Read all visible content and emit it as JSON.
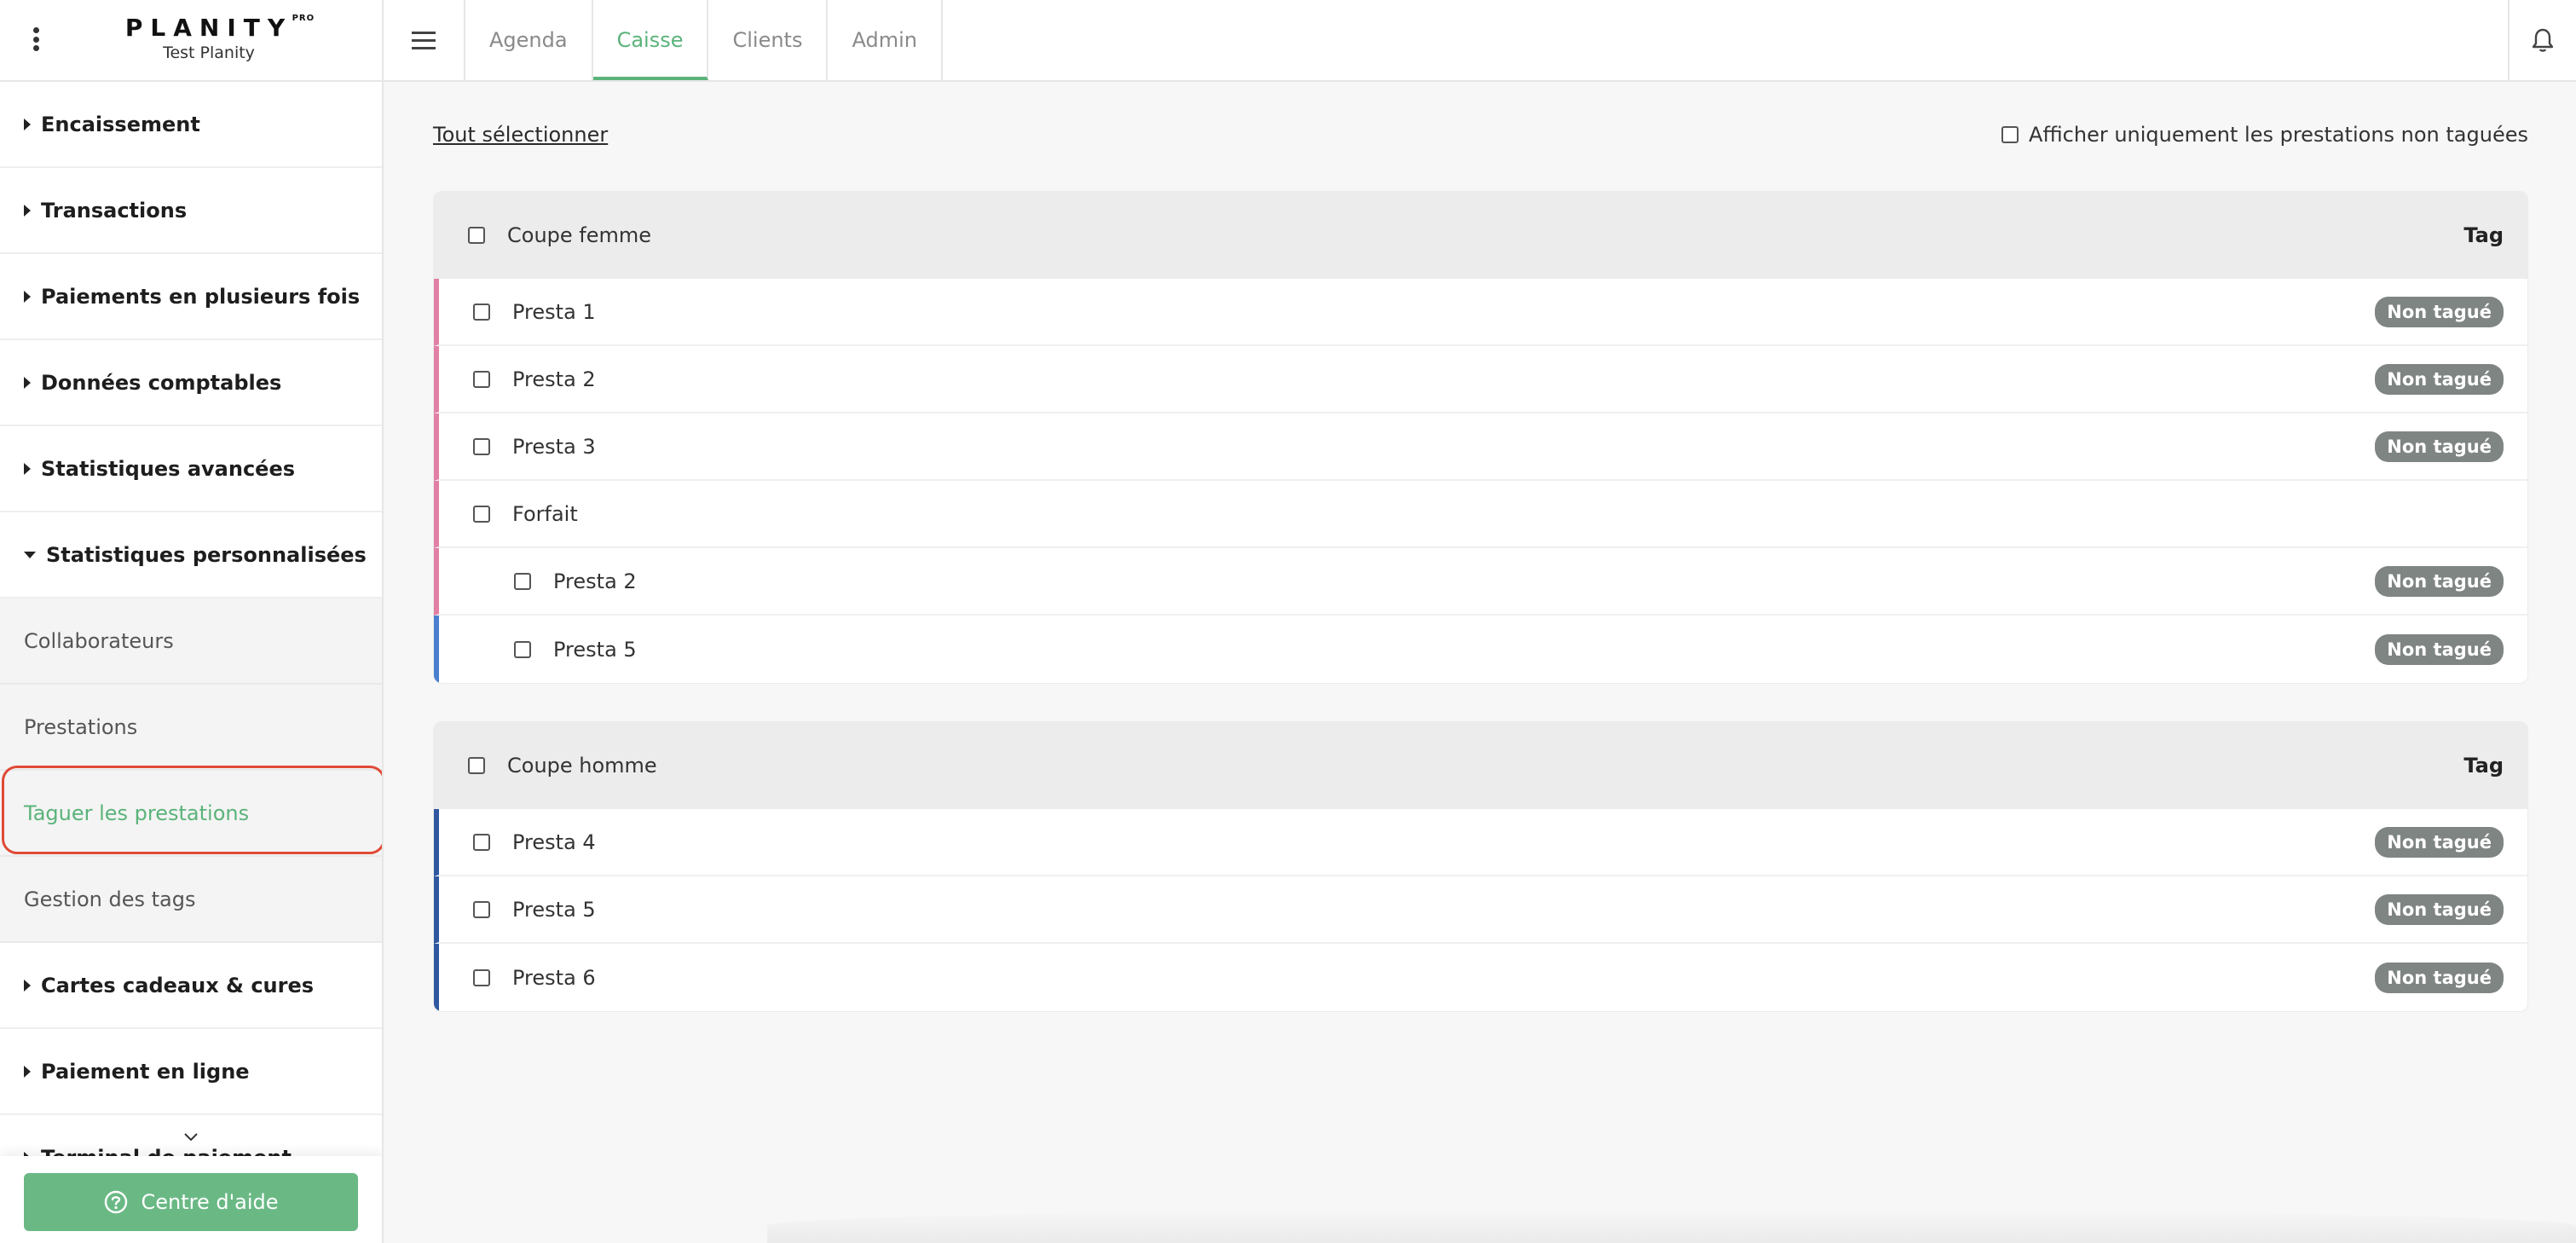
{
  "brand": {
    "name": "PLANITY",
    "badge": "PRO",
    "salon": "Test Planity"
  },
  "nav": {
    "tabs": [
      {
        "label": "Agenda"
      },
      {
        "label": "Caisse"
      },
      {
        "label": "Clients"
      },
      {
        "label": "Admin"
      }
    ],
    "active_tab": "Caisse"
  },
  "sidebar": {
    "items": [
      {
        "label": "Encaissement"
      },
      {
        "label": "Transactions"
      },
      {
        "label": "Paiements en plusieurs fois"
      },
      {
        "label": "Données comptables"
      },
      {
        "label": "Statistiques avancées"
      },
      {
        "label": "Statistiques personnalisées"
      },
      {
        "label": "Cartes cadeaux & cures"
      },
      {
        "label": "Paiement en ligne"
      },
      {
        "label": "Terminal de paiement"
      }
    ],
    "subitems": [
      {
        "label": "Collaborateurs"
      },
      {
        "label": "Prestations"
      },
      {
        "label": "Taguer les prestations"
      },
      {
        "label": "Gestion des tags"
      }
    ],
    "help_label": "Centre d'aide"
  },
  "main": {
    "select_all": "Tout sélectionner",
    "filter_label": "Afficher uniquement les prestations non taguées",
    "groups": [
      {
        "name": "Coupe femme",
        "tag_header": "Tag",
        "rows": [
          {
            "label": "Presta 1",
            "tag": "Non tagué"
          },
          {
            "label": "Presta 2",
            "tag": "Non tagué"
          },
          {
            "label": "Presta 3",
            "tag": "Non tagué"
          },
          {
            "label": "Forfait",
            "tag": ""
          },
          {
            "label": "Presta 2",
            "tag": "Non tagué"
          },
          {
            "label": "Presta 5",
            "tag": "Non tagué"
          }
        ]
      },
      {
        "name": "Coupe homme",
        "tag_header": "Tag",
        "rows": [
          {
            "label": "Presta 4",
            "tag": "Non tagué"
          },
          {
            "label": "Presta 5",
            "tag": "Non tagué"
          },
          {
            "label": "Presta 6",
            "tag": "Non tagué"
          }
        ]
      }
    ]
  },
  "colors": {
    "accent_green": "#5bb37a",
    "help_green": "#6ab985",
    "highlight_red": "#e04a36",
    "stripe_pink": "#e27fa4",
    "stripe_blue": "#4a7fd0",
    "stripe_navy": "#2f57a0",
    "badge_gray": "#7f8582"
  }
}
